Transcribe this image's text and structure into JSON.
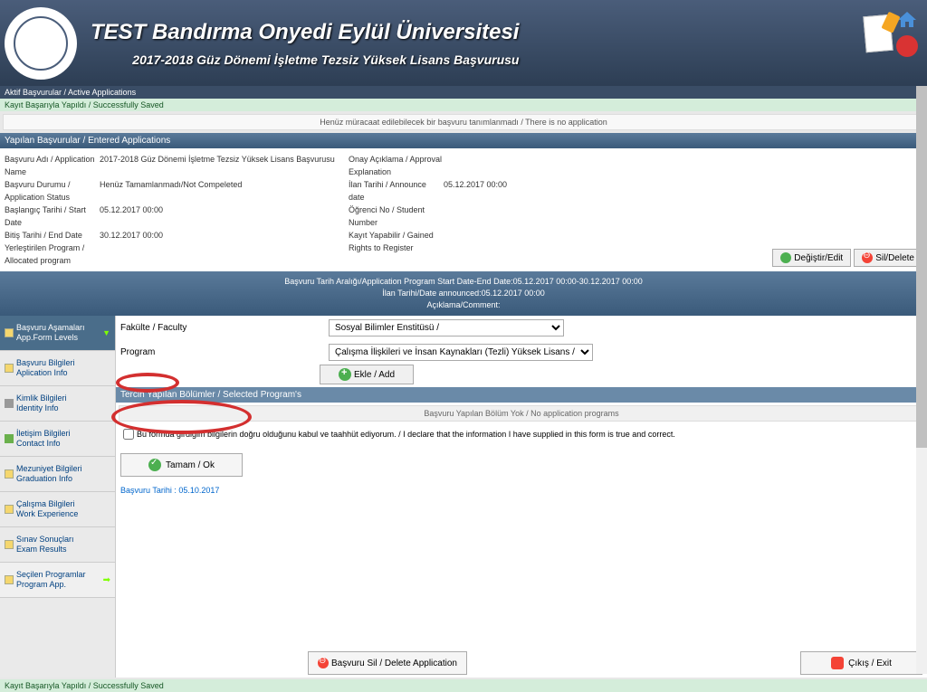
{
  "header": {
    "title": "TEST Bandırma Onyedi Eylül Üniversitesi",
    "subtitle": "2017-2018 Güz Dönemi İşletme Tezsiz Yüksek Lisans Başvurusu"
  },
  "breadcrumb": "Aktif Başvurular / Active Applications",
  "success_msg": "Kayıt Başarıyla Yapıldı / Successfully Saved",
  "notice": "Henüz müracaat edilebilecek bir başvuru tanımlanmadı / There is no application",
  "section_entered": "Yapılan Başvurular / Entered Applications",
  "details": {
    "name_label": "Başvuru Adı / Application Name",
    "name_value": "2017-2018 Güz Dönemi İşletme Tezsiz Yüksek Lisans Başvurusu",
    "status_label": "Başvuru Durumu / Application Status",
    "status_value": "Henüz Tamamlanmadı/Not Compeleted",
    "start_label": "Başlangıç Tarihi / Start Date",
    "start_value": "05.12.2017 00:00",
    "end_label": "Bitiş Tarihi / End Date",
    "end_value": "30.12.2017 00:00",
    "allocated_label": "Yerleştirilen Program / Allocated program",
    "allocated_value": "",
    "approval_label": "Onay Açıklama / Approval Explanation",
    "approval_value": "",
    "announce_label": "İlan Tarihi / Announce date",
    "announce_value": "05.12.2017 00:00",
    "student_label": "Öğrenci No / Student Number",
    "student_value": "",
    "rights_label": "Kayıt Yapabilir / Gained Rights to Register",
    "rights_value": ""
  },
  "buttons": {
    "edit": "Değiştir/Edit",
    "delete": "Sil/Delete",
    "add": "Ekle / Add",
    "ok": "Tamam / Ok",
    "delete_app": "Başvuru Sil / Delete Application",
    "exit": "Çıkış / Exit"
  },
  "info_banner": {
    "line1": "Başvuru Tarih Aralığı/Application Program Start Date-End Date:05.12.2017 00:00-30.12.2017 00:00",
    "line2": "İlan Tarihi/Date announced:05.12.2017 00:00",
    "line3": "Açıklama/Comment:"
  },
  "sidebar": {
    "items": [
      {
        "title": "Başvuru Aşamaları",
        "sub": "App.Form Levels"
      },
      {
        "title": "Başvuru Bilgileri",
        "sub": "Aplication Info"
      },
      {
        "title": "Kimlik Bilgileri",
        "sub": "Identity Info"
      },
      {
        "title": "İletişim Bilgileri",
        "sub": "Contact Info"
      },
      {
        "title": "Mezuniyet Bilgileri",
        "sub": "Graduation Info"
      },
      {
        "title": "Çalışma Bilgileri",
        "sub": "Work Experience"
      },
      {
        "title": "Sınav Sonuçları",
        "sub": "Exam Results"
      },
      {
        "title": "Seçilen Programlar",
        "sub": "Program App."
      }
    ]
  },
  "form": {
    "faculty_label": "Fakülte / Faculty",
    "faculty_value": "Sosyal Bilimler Enstitüsü /",
    "program_label": "Program",
    "program_value": "Çalışma İlişkileri ve İnsan Kaynakları (Tezli) Yüksek Lisans /"
  },
  "subsection": "Tercih Yapılan Bölümler / Selected Program's",
  "no_programs": "Başvuru Yapılan Bölüm Yok / No application programs",
  "declaration": "Bu formda girdiğim bilgilerin doğru olduğunu kabul ve taahhüt ediyorum. / I declare that the information I have supplied in this form is true and correct.",
  "app_date": "Başvuru Tarihi : 05.10.2017",
  "footer_status": "Kayıt Başarıyla Yapıldı / Successfully Saved"
}
